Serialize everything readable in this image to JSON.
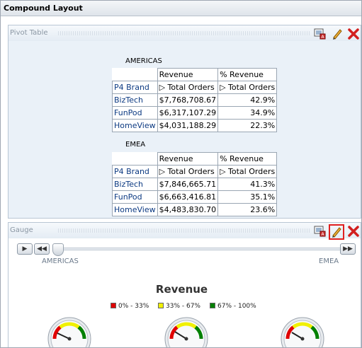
{
  "layout": {
    "title": "Compound Layout"
  },
  "pivot": {
    "section_title": "Pivot Table",
    "tables": [
      {
        "country": "AMERICAS",
        "headers": [
          "Revenue",
          "% Revenue"
        ],
        "row_header": "P4 Brand",
        "sub_headers": [
          "▷ Total Orders",
          "▷ Total Orders"
        ],
        "rows": [
          {
            "brand": "BizTech",
            "revenue": "$7,768,708.67",
            "pct": "42.9%"
          },
          {
            "brand": "FunPod",
            "revenue": "$6,317,107.29",
            "pct": "34.9%"
          },
          {
            "brand": "HomeView",
            "revenue": "$4,031,188.29",
            "pct": "22.3%"
          }
        ]
      },
      {
        "country": "EMEA",
        "headers": [
          "Revenue",
          "% Revenue"
        ],
        "row_header": "P4 Brand",
        "sub_headers": [
          "▷ Total Orders",
          "▷ Total Orders"
        ],
        "rows": [
          {
            "brand": "BizTech",
            "revenue": "$7,846,665.71",
            "pct": "41.3%"
          },
          {
            "brand": "FunPod",
            "revenue": "$6,663,416.81",
            "pct": "35.1%"
          },
          {
            "brand": "HomeView",
            "revenue": "$4,483,830.70",
            "pct": "23.6%"
          }
        ]
      }
    ]
  },
  "gauge": {
    "section_title": "Gauge",
    "slider": {
      "labels": [
        "AMERICAS",
        "EMEA"
      ],
      "buttons": {
        "play": "▶",
        "prev": "◀◀",
        "next": "▶▶"
      },
      "position": 0
    },
    "title": "Revenue",
    "legend": [
      {
        "label": "0% - 33%",
        "color": "#e00000"
      },
      {
        "label": "33% - 67%",
        "color": "#f0f000"
      },
      {
        "label": "67% - 100%",
        "color": "#008000"
      }
    ],
    "colors": {
      "low": "#e00000",
      "mid": "#f0f000",
      "high": "#008000"
    }
  },
  "icons": {
    "edit": "pencil-icon",
    "delete": "close-icon",
    "view": "view-icon"
  }
}
